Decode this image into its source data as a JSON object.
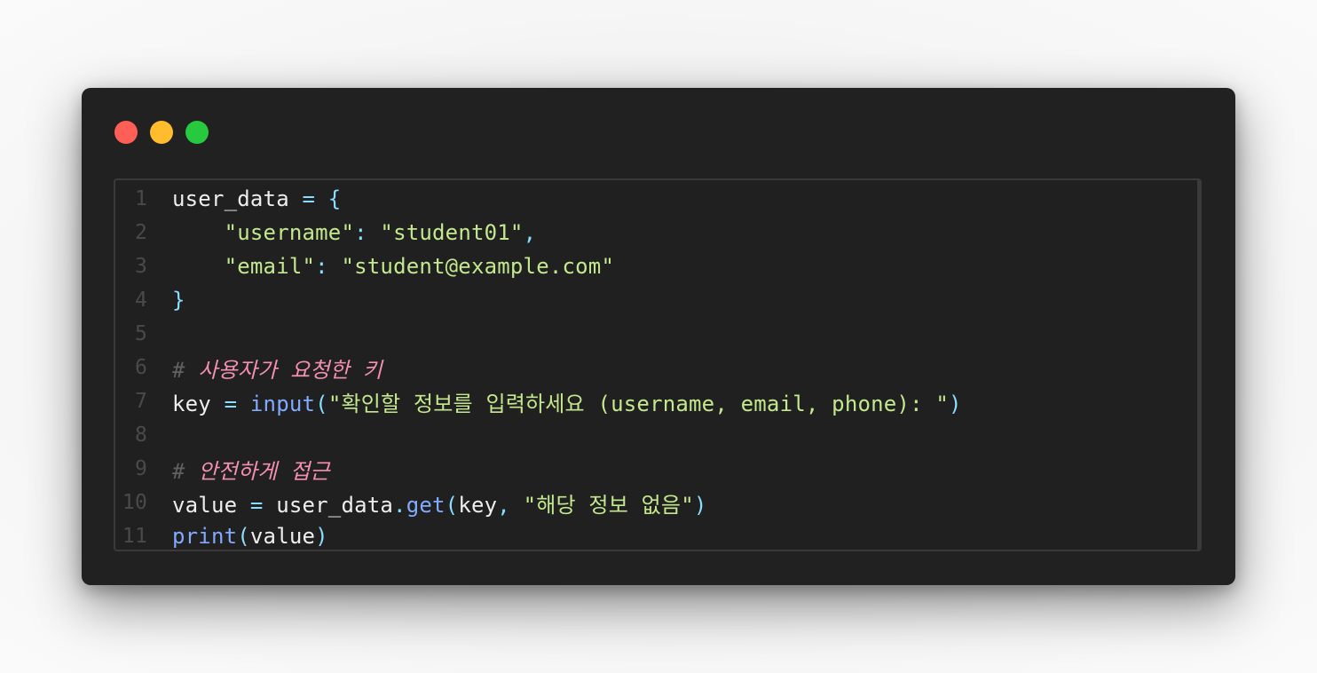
{
  "window": {
    "controls": [
      {
        "name": "close",
        "color": "#ff5f56"
      },
      {
        "name": "minimize",
        "color": "#ffbd2e"
      },
      {
        "name": "maximize",
        "color": "#27c93f"
      }
    ]
  },
  "editor": {
    "language": "python",
    "lines": [
      {
        "n": "1",
        "tokens": [
          {
            "t": "user_data",
            "c": "var"
          },
          {
            "t": " = ",
            "c": "op"
          },
          {
            "t": "{",
            "c": "brace"
          }
        ]
      },
      {
        "n": "2",
        "tokens": [
          {
            "t": "    ",
            "c": "var"
          },
          {
            "t": "\"username\"",
            "c": "str"
          },
          {
            "t": ": ",
            "c": "op"
          },
          {
            "t": "\"student01\"",
            "c": "str"
          },
          {
            "t": ",",
            "c": "op"
          }
        ]
      },
      {
        "n": "3",
        "tokens": [
          {
            "t": "    ",
            "c": "var"
          },
          {
            "t": "\"email\"",
            "c": "str"
          },
          {
            "t": ": ",
            "c": "op"
          },
          {
            "t": "\"student@example.com\"",
            "c": "str"
          }
        ]
      },
      {
        "n": "4",
        "tokens": [
          {
            "t": "}",
            "c": "brace"
          }
        ]
      },
      {
        "n": "5",
        "tokens": []
      },
      {
        "n": "6",
        "tokens": [
          {
            "t": "# ",
            "c": "comment"
          },
          {
            "t": "사용자가 요청한 키",
            "c": "comment-text"
          }
        ]
      },
      {
        "n": "7",
        "tokens": [
          {
            "t": "key",
            "c": "var"
          },
          {
            "t": " = ",
            "c": "op"
          },
          {
            "t": "input",
            "c": "fn"
          },
          {
            "t": "(",
            "c": "paren"
          },
          {
            "t": "\"확인할 정보를 입력하세요 (username, email, phone): \"",
            "c": "str"
          },
          {
            "t": ")",
            "c": "paren"
          }
        ]
      },
      {
        "n": "8",
        "tokens": []
      },
      {
        "n": "9",
        "tokens": [
          {
            "t": "# ",
            "c": "comment"
          },
          {
            "t": "안전하게 접근",
            "c": "comment-text"
          }
        ]
      },
      {
        "n": "10",
        "tokens": [
          {
            "t": "value",
            "c": "var"
          },
          {
            "t": " = ",
            "c": "op"
          },
          {
            "t": "user_data",
            "c": "var"
          },
          {
            "t": ".",
            "c": "op"
          },
          {
            "t": "get",
            "c": "fn"
          },
          {
            "t": "(",
            "c": "paren"
          },
          {
            "t": "key",
            "c": "var"
          },
          {
            "t": ", ",
            "c": "op"
          },
          {
            "t": "\"해당 정보 없음\"",
            "c": "str"
          },
          {
            "t": ")",
            "c": "paren"
          }
        ]
      },
      {
        "n": "11",
        "tokens": [
          {
            "t": "print",
            "c": "fn"
          },
          {
            "t": "(",
            "c": "paren"
          },
          {
            "t": "value",
            "c": "var"
          },
          {
            "t": ")",
            "c": "paren"
          }
        ]
      }
    ]
  }
}
